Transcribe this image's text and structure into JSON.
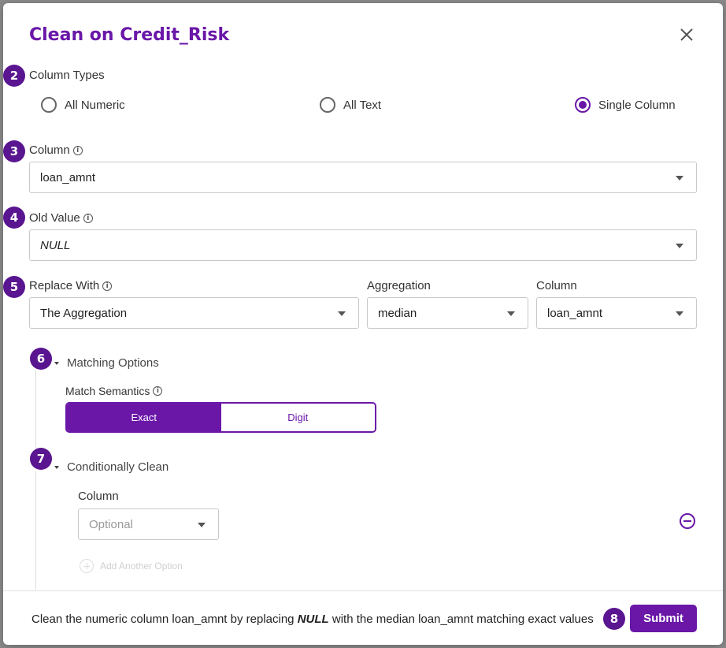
{
  "dialog": {
    "title": "Clean on Credit_Risk"
  },
  "steps": {
    "s2": "2",
    "s3": "3",
    "s4": "4",
    "s5": "5",
    "s6": "6",
    "s7": "7",
    "s8": "8"
  },
  "column_types": {
    "label": "Column Types",
    "options": [
      "All Numeric",
      "All Text",
      "Single Column"
    ],
    "selected": "Single Column"
  },
  "column": {
    "label": "Column",
    "value": "loan_amnt"
  },
  "old_value": {
    "label": "Old Value",
    "value": "NULL"
  },
  "replace_with": {
    "label": "Replace With",
    "value": "The Aggregation"
  },
  "aggregation": {
    "label": "Aggregation",
    "value": "median"
  },
  "agg_column": {
    "label": "Column",
    "value": "loan_amnt"
  },
  "matching": {
    "header": "Matching Options",
    "semantics_label": "Match Semantics",
    "options": [
      "Exact",
      "Digit"
    ],
    "selected": "Exact"
  },
  "conditional": {
    "header": "Conditionally Clean",
    "column_label": "Column",
    "column_placeholder": "Optional",
    "add_label": "Add Another Option"
  },
  "footer": {
    "summary_pre": "Clean the numeric column loan_amnt by replacing",
    "summary_value": "NULL",
    "summary_post": "with the median loan_amnt matching exact values",
    "submit_label": "Submit"
  },
  "colors": {
    "accent": "#6a17a8",
    "badge": "#5a1590"
  }
}
